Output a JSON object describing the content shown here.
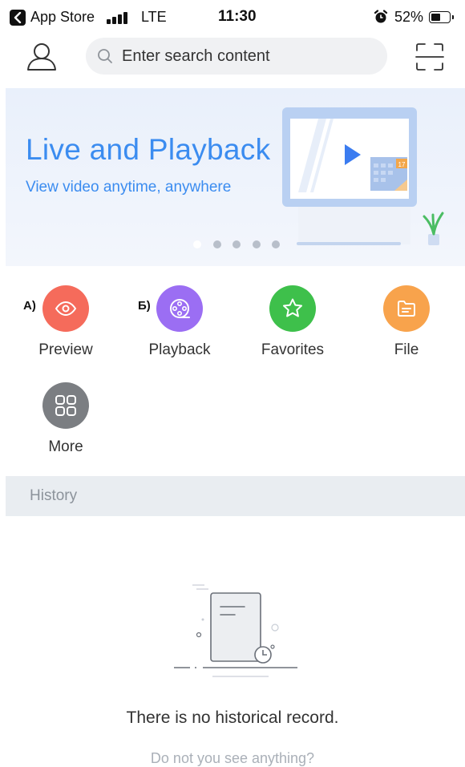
{
  "status_bar": {
    "back_app": "App Store",
    "network": "LTE",
    "time": "11:30",
    "battery": "52%",
    "battery_level": 0.52
  },
  "header": {
    "search_placeholder": "Enter search content"
  },
  "banner": {
    "title": "Live and Playback",
    "subtitle": "View video anytime, anywhere",
    "calendar_day": "17",
    "slide_count": 5,
    "active_slide": 1
  },
  "tags": {
    "a": "А)",
    "b": "Б)"
  },
  "grid": [
    {
      "label": "Preview",
      "color": "#f56b5b",
      "icon": "eye-icon"
    },
    {
      "label": "Playback",
      "color": "#9b6ef3",
      "icon": "film-reel-icon"
    },
    {
      "label": "Favorites",
      "color": "#3ec04b",
      "icon": "star-icon"
    },
    {
      "label": "File",
      "color": "#f8a34c",
      "icon": "folder-icon"
    },
    {
      "label": "More",
      "color": "#7b7e82",
      "icon": "four-squares-icon"
    }
  ],
  "history": {
    "title": "History",
    "empty_text": "There is no historical record.",
    "empty_hint": "Do not you see anything?"
  },
  "colors": {
    "accent": "#3b8cf0"
  }
}
